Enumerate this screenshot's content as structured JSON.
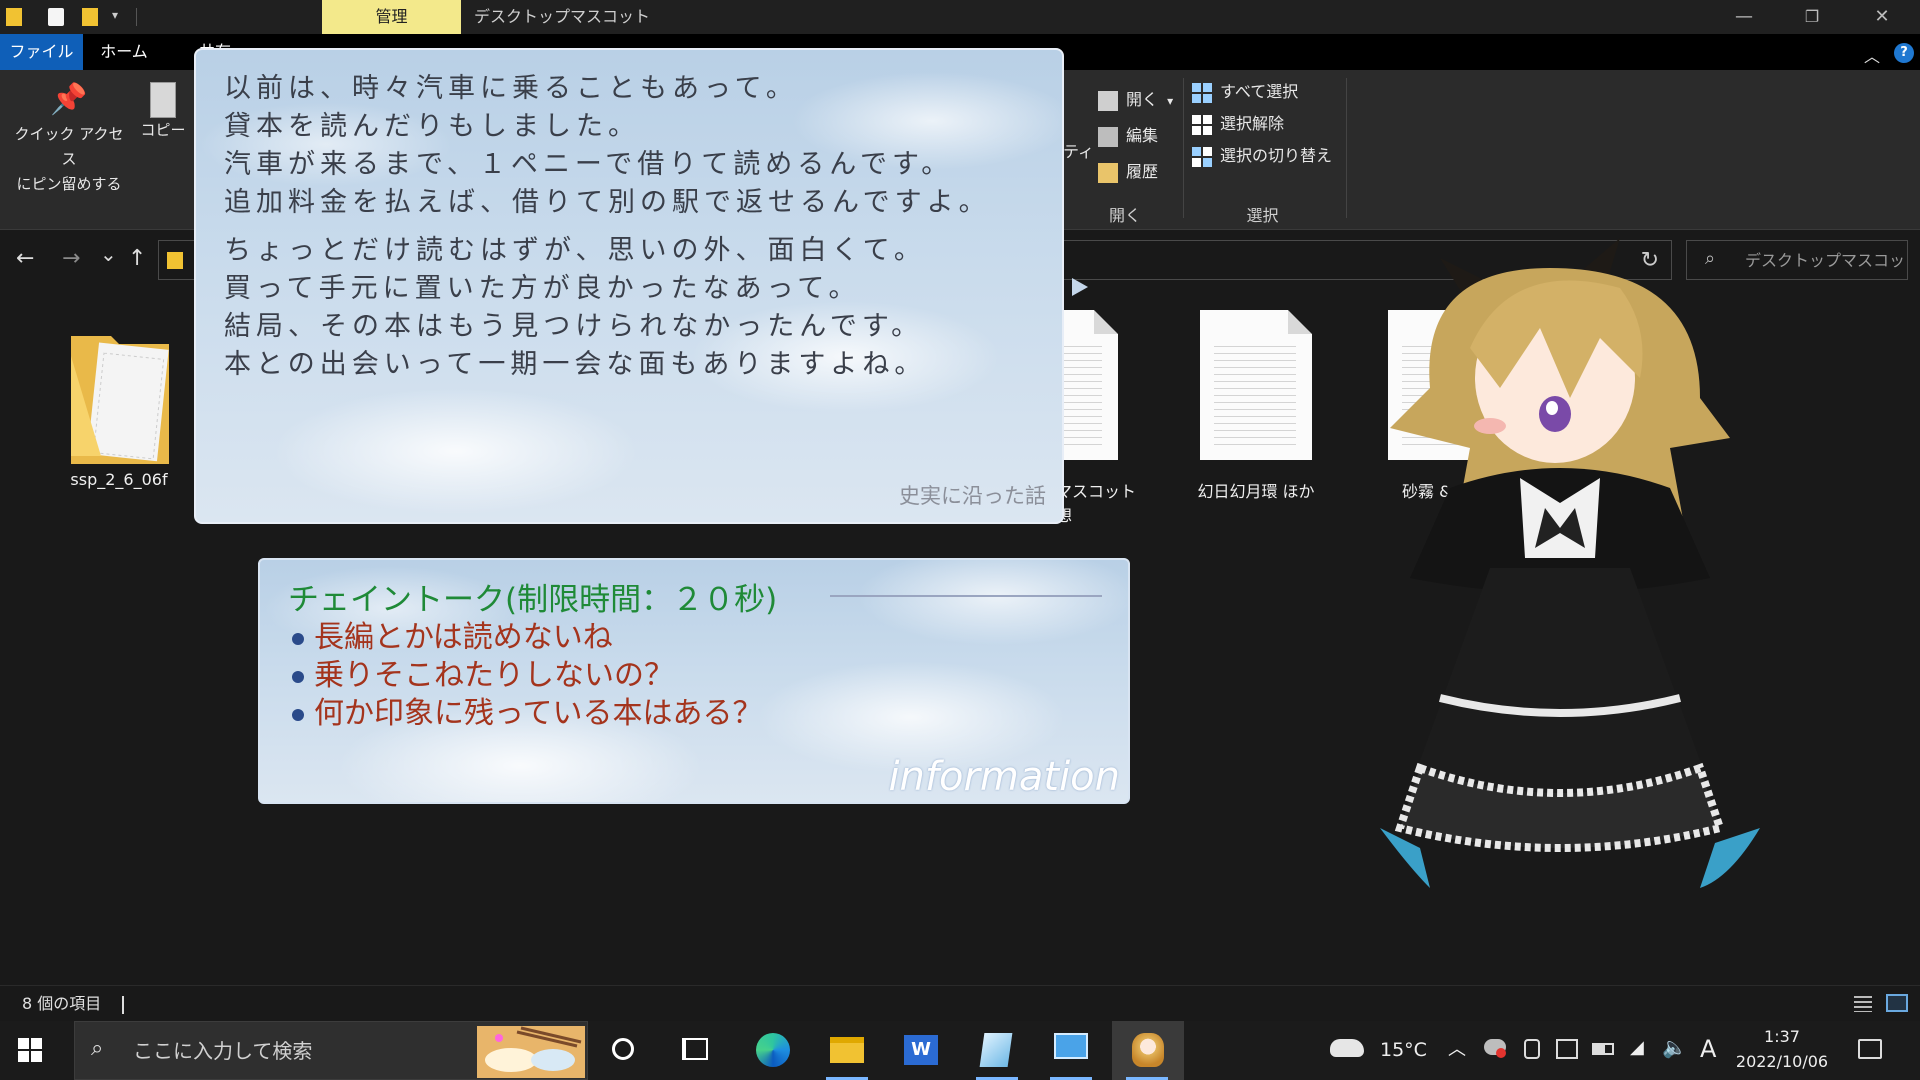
{
  "titlebar": {
    "manage_tab": "管理",
    "window_title": "デスクトップマスコット",
    "controls": [
      "—",
      "❐",
      "✕"
    ]
  },
  "ribbon_tabs": {
    "file": "ファイル",
    "home": "ホーム",
    "share": "共有"
  },
  "ribbon": {
    "pin": "クイック アクセス\nにピン留めする",
    "copy": "コピー",
    "properties_fragment": "ティ",
    "open": "開く",
    "open_dropdown": "▾",
    "edit": "編集",
    "history": "履歴",
    "group_open": "開く",
    "select_all": "すべて選択",
    "select_none": "選択解除",
    "invert_selection": "選択の切り替え",
    "group_select": "選択"
  },
  "navigation": {
    "back": "←",
    "forward": "→",
    "recent": "⌄",
    "up": "↑",
    "refresh": "↻",
    "search_placeholder": "デスクトップマスコット..."
  },
  "files": [
    {
      "name": "ssp_2_6_06f",
      "type": "folder"
    },
    {
      "name": "マスコット\n想",
      "type": "document"
    },
    {
      "name": "幻日幻月環 ほか",
      "type": "document"
    },
    {
      "name": "砂霧 &",
      "type": "document"
    }
  ],
  "balloon": {
    "paragraph1": [
      "以前は、時々汽車に乗ることもあって。",
      "貸本を読んだりもしました。",
      "汽車が来るまで、１ペニーで借りて読めるんです。",
      "追加料金を払えば、借りて別の駅で返せるんですよ。"
    ],
    "paragraph2": [
      "ちょっとだけ読むはずが、思いの外、面白くて。",
      "買って手元に置いた方が良かったなあって。",
      "結局、その本はもう見つけられなかったんです。",
      "本との出会いって一期一会な面もありますよね。"
    ],
    "caption": "史実に沿った話"
  },
  "chain_talk": {
    "title": "チェイントーク(制限時間：２０秒)",
    "choices": [
      "長編とかは読めないね",
      "乗りそこねたりしないの？",
      "何か印象に残っている本はある？"
    ],
    "label": "information"
  },
  "statusbar": {
    "item_count": "8 個の項目"
  },
  "taskbar": {
    "search_placeholder": "ここに入力して検索",
    "weather_temp": "15°C",
    "ime": "A",
    "time": "1:37",
    "date": "2022/10/06"
  },
  "colors": {
    "accent_blue": "#0f5fb8",
    "manage_tab_yellow": "#f3e98b",
    "chain_title_green": "#1f8a37",
    "choice_red": "#a4341d"
  }
}
